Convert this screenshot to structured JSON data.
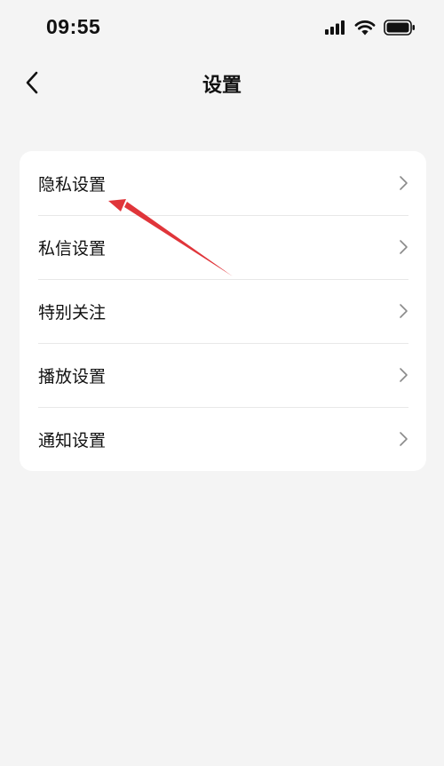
{
  "status_bar": {
    "time": "09:55"
  },
  "nav": {
    "title": "设置"
  },
  "settings": {
    "items": [
      {
        "label": "隐私设置"
      },
      {
        "label": "私信设置"
      },
      {
        "label": "特别关注"
      },
      {
        "label": "播放设置"
      },
      {
        "label": "通知设置"
      }
    ]
  },
  "colors": {
    "background": "#f4f4f4",
    "card": "#ffffff",
    "annotation_arrow": "#e0353a"
  }
}
